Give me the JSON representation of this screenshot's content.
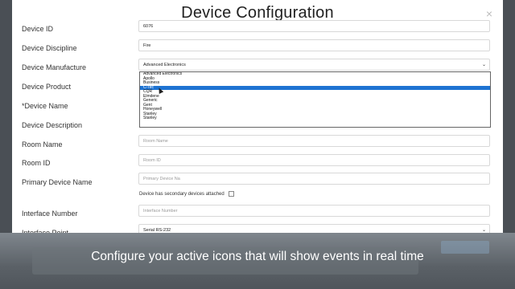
{
  "modal": {
    "title": "Device Configuration",
    "close_glyph": "×"
  },
  "labels": {
    "device_id": "Device ID",
    "device_discipline": "Device Discipline",
    "device_manufacture": "Device Manufacture",
    "device_product": "Device Product",
    "device_name": "*Device Name",
    "device_description": "Device Description",
    "room_name": "Room Name",
    "room_id": "Room ID",
    "primary_device_name": "Primary Device Name",
    "interface_number": "Interface Number",
    "interface_point": "Interface Point"
  },
  "fields": {
    "device_id_value": "6076",
    "discipline_value": "Fire",
    "manufacture_value": "Advanced Electronics",
    "room_name_placeholder": "Room Name",
    "room_id_placeholder": "Room ID",
    "primary_device_placeholder": "Primary Device Na",
    "secondary_checkbox_label": "Device has secondary devices attached",
    "interface_number_placeholder": "Interface Number",
    "interface_point_value": "Serial RS-232"
  },
  "dropdown": {
    "options": [
      "Advanced Electronics",
      "Apollo",
      "Business",
      "C-Tec",
      "CQR",
      "Elmdene",
      "Generic",
      "Gent",
      "Honeywell",
      "Stanley",
      "Stanley"
    ],
    "selected_index": 3
  },
  "caption": "Configure your active icons that will show events in real time",
  "colors": {
    "accent": "#1e73d2",
    "overlay": "#5b6167"
  }
}
